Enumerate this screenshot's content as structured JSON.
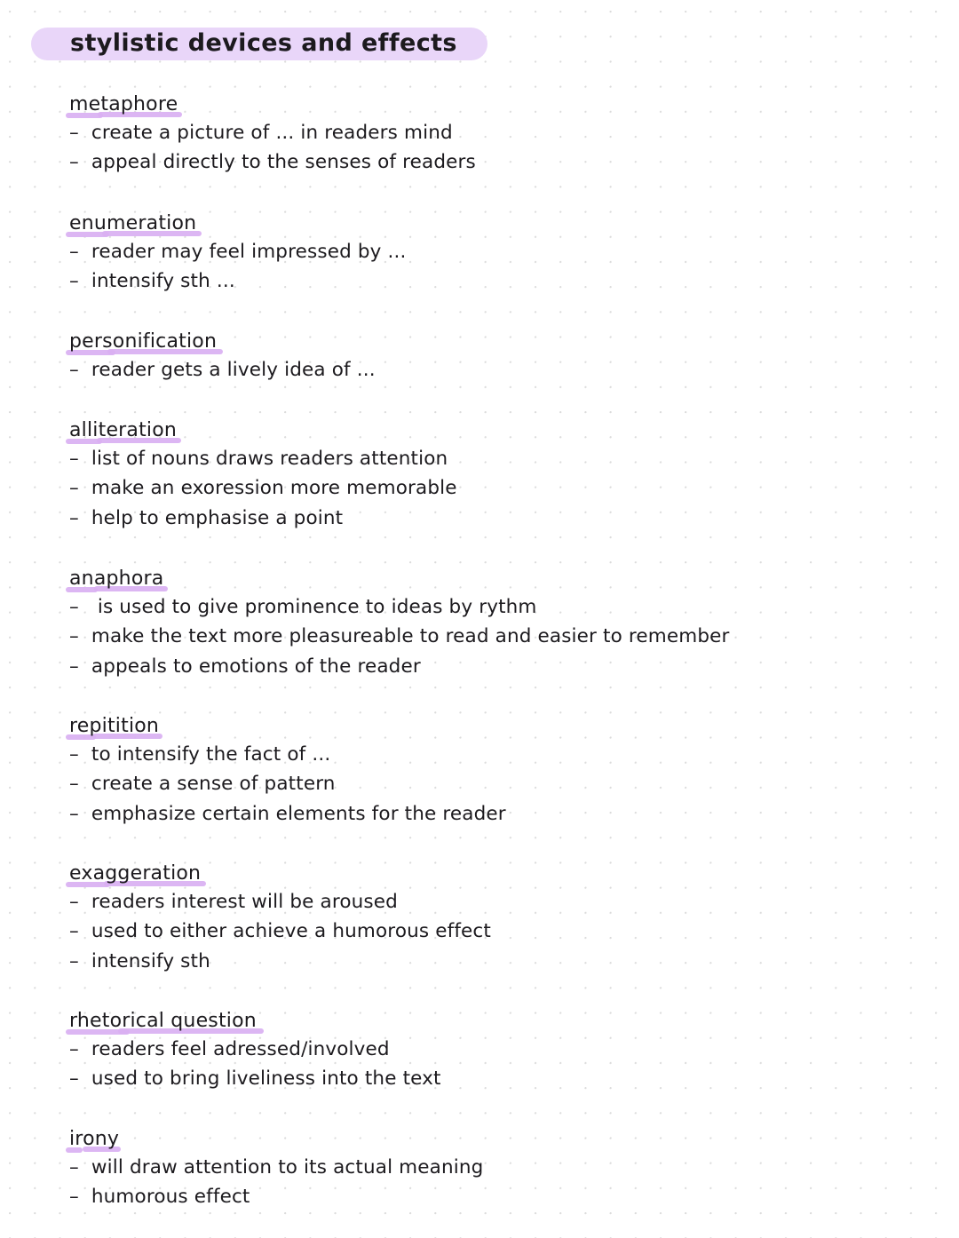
{
  "page": {
    "background_color": "#ffffff",
    "dot_grid_color": "#dcdcdc",
    "text_color": "#1c1a1e",
    "highlight_pill_color": "#e9d6f9",
    "underline_marker_color": "#d9b0f2"
  },
  "title": {
    "text": "stylistic devices and effects"
  },
  "sections": [
    {
      "heading": "metaphore",
      "bullets": [
        "–  create a picture of ... in readers mind",
        "–  appeal directly to the senses of readers"
      ]
    },
    {
      "heading": "enumeration",
      "bullets": [
        "–  reader may feel impressed by ...",
        "–  intensify sth ..."
      ]
    },
    {
      "heading": "personification",
      "bullets": [
        "–  reader gets a lively idea of ..."
      ]
    },
    {
      "heading": "alliteration",
      "bullets": [
        "–  list of nouns draws readers attention",
        "–  make an exoression more memorable",
        "–  help to emphasise a point"
      ]
    },
    {
      "heading": "anaphora",
      "bullets": [
        "–   is used to give prominence to ideas by rythm",
        "–  make the text more pleasureable to read and easier to remember",
        "–  appeals to emotions of the reader"
      ]
    },
    {
      "heading": "repitition",
      "bullets": [
        "–  to intensify the fact of ...",
        "–  create a sense of pattern",
        "–  emphasize certain elements for the reader"
      ]
    },
    {
      "heading": "exaggeration",
      "bullets": [
        "–  readers interest will be aroused",
        "–  used to either achieve a humorous effect",
        "–  intensify sth"
      ]
    },
    {
      "heading": "rhetorical question",
      "bullets": [
        "–  readers feel adressed/involved",
        "–  used to bring liveliness into the text"
      ]
    },
    {
      "heading": "irony",
      "bullets": [
        "–  will draw attention to its actual meaning",
        "–  humorous effect"
      ]
    }
  ],
  "layout": {
    "section_tops": [
      105,
      239,
      372,
      472,
      639,
      805,
      971,
      1137,
      1270
    ]
  }
}
